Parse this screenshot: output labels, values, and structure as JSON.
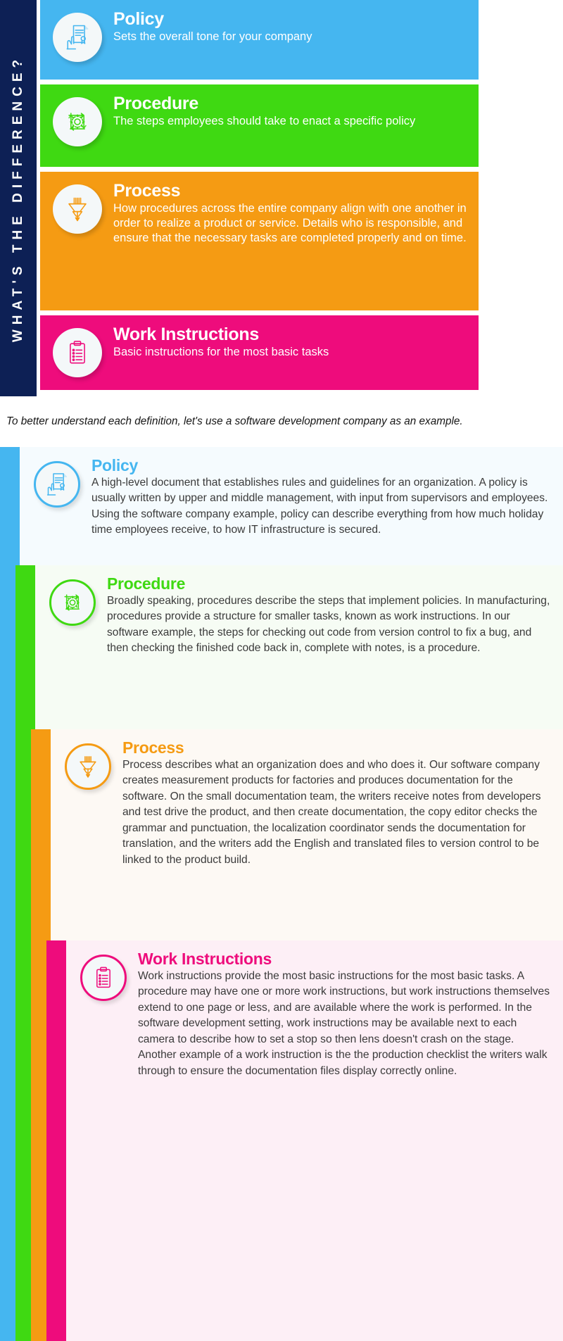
{
  "banner": {
    "vertical_title": "WHAT'S THE DIFFERENCE?",
    "background_color": "#0d2055"
  },
  "colors": {
    "policy": "#45b6f0",
    "procedure": "#3fd912",
    "process": "#f59b13",
    "work_instructions": "#ee0c7c",
    "banner_navy": "#0d2055",
    "badge_fill": "#f4f8f9"
  },
  "summary_cards": [
    {
      "icon": "hand-holding-certificate-icon",
      "title": "Policy",
      "description": "Sets the overall tone for your company",
      "color": "#45b6f0"
    },
    {
      "icon": "gear-cycle-icon",
      "title": "Procedure",
      "description": "The steps employees should take to enact a specific policy",
      "color": "#3fd912"
    },
    {
      "icon": "funnel-filter-icon",
      "title": "Process",
      "description": "How procedures across the entire company align with one another in order to realize a product or service. Details who  is responsible, and ensure that the necessary tasks are completed properly and on time.",
      "color": "#f59b13"
    },
    {
      "icon": "clipboard-checklist-icon",
      "title": "Work Instructions",
      "description": "Basic instructions for the most basic tasks",
      "color": "#ee0c7c"
    }
  ],
  "divider": {
    "note": "To better understand each definition, let's use a software development company as an example."
  },
  "detail_cards": [
    {
      "icon": "hand-holding-certificate-icon",
      "title": "Policy",
      "description": "A high-level document that establishes rules and guidelines for an organization. A policy is usually written by upper and middle management, with input from supervisors and employees. Using the software company example, policy can describe everything from how much holiday time employees receive, to how IT infrastructure is secured.",
      "color": "#45b6f0",
      "background": "#f5fbfe"
    },
    {
      "icon": "gear-cycle-icon",
      "title": "Procedure",
      "description": "Broadly speaking, procedures describe the steps that implement policies. In manufacturing, procedures provide a structure for smaller tasks, known as work instructions. In our software example, the steps for checking out code from version control to fix a bug, and then checking the finished code back in, complete with notes, is a procedure.",
      "color": "#3fd912",
      "background": "#f6fcf4"
    },
    {
      "icon": "funnel-filter-icon",
      "title": "Process",
      "description": "Process describes what an organization does and who does it. Our software company creates measurement products for factories and produces documentation for the software. On the small documentation team, the writers receive notes from developers and test drive the product, and then create documentation, the copy editor checks the grammar and punctuation, the localization coordinator sends the documentation for translation, and the writers add the English and translated files to version control to be linked to the product build.",
      "color": "#f59b13",
      "background": "#fdf9f4"
    },
    {
      "icon": "clipboard-checklist-icon",
      "title": "Work Instructions",
      "description": "Work instructions provide the most basic instructions for the most basic tasks. A procedure may have one or more work instructions, but work instructions themselves extend to one page or less, and are available where the work is performed. In the software development setting, work instructions may be available next to each camera to describe how to set a stop so then lens doesn't crash on the stage. Another example of a work instruction is the the production checklist the writers walk through to ensure the documentation files display correctly online.",
      "color": "#ee0c7c",
      "background": "#fdeff6"
    }
  ]
}
